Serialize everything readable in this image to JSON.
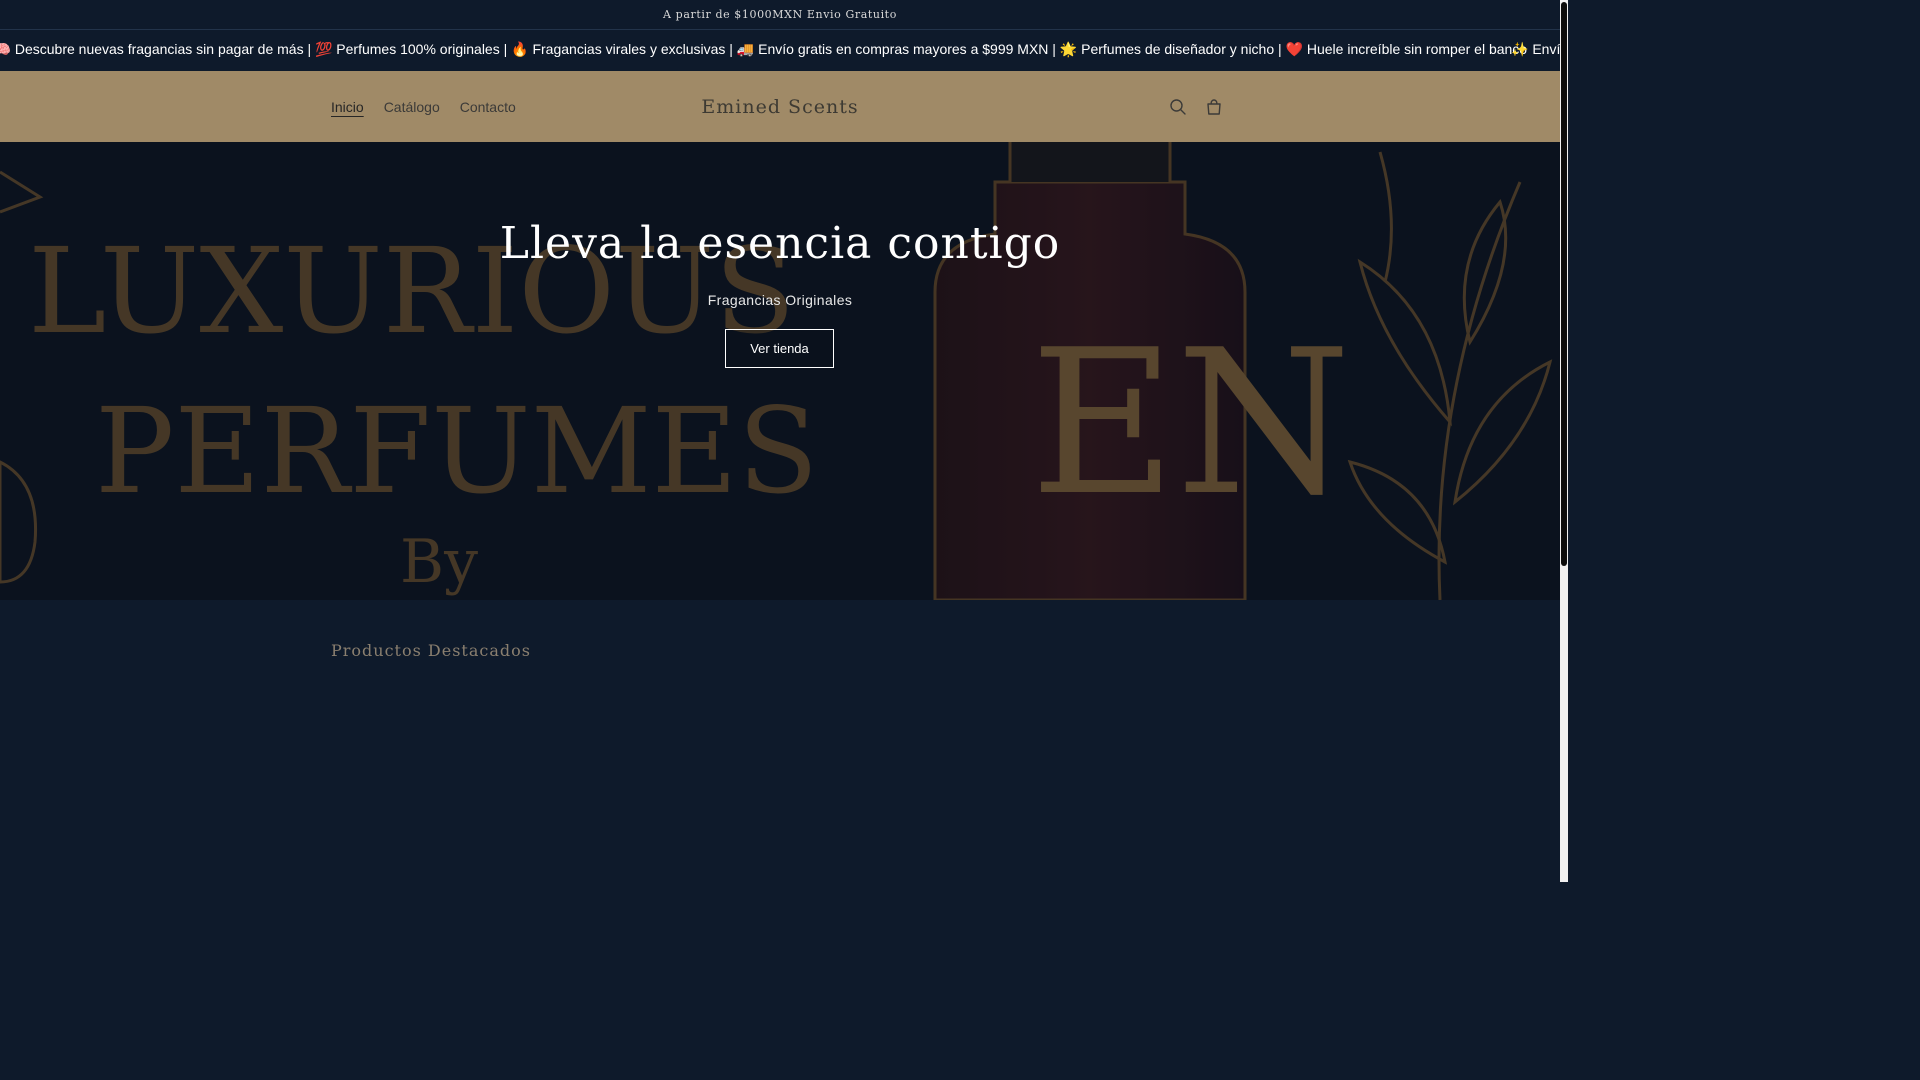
{
  "announcement": {
    "text": "A partir de $1000MXN Envio Gratuito"
  },
  "marquee": {
    "text": "| 🧠 Descubre nuevas fragancias sin pagar de más | 💯 Perfumes 100% originales | 🔥 Fragancias virales y exclusivas | 🚚 Envío gratis en compras mayores a $999 MXN | 🌟 Perfumes de diseñador y nicho | ❤️ Huele increíble sin romper el banco",
    "text_next": "✨ Envío"
  },
  "header": {
    "nav": [
      {
        "label": "Inicio",
        "active": true
      },
      {
        "label": "Catálogo",
        "active": false
      },
      {
        "label": "Contacto",
        "active": false
      }
    ],
    "logo": "Emined Scents",
    "search_icon": "search-icon",
    "cart_icon": "cart-icon"
  },
  "hero": {
    "title": "Lleva la esencia contigo",
    "subtitle": "Fragancias Originales",
    "button": "Ver tienda",
    "background_text_line1": "LUXURIOUS",
    "background_text_line2": "PERFUMES",
    "background_text_line3": "By",
    "monogram": "EN"
  },
  "featured": {
    "title": "Productos Destacados"
  },
  "colors": {
    "header_bg": "#a08a67",
    "page_bg": "#0e1a2b",
    "gold": "#b08a4e"
  }
}
